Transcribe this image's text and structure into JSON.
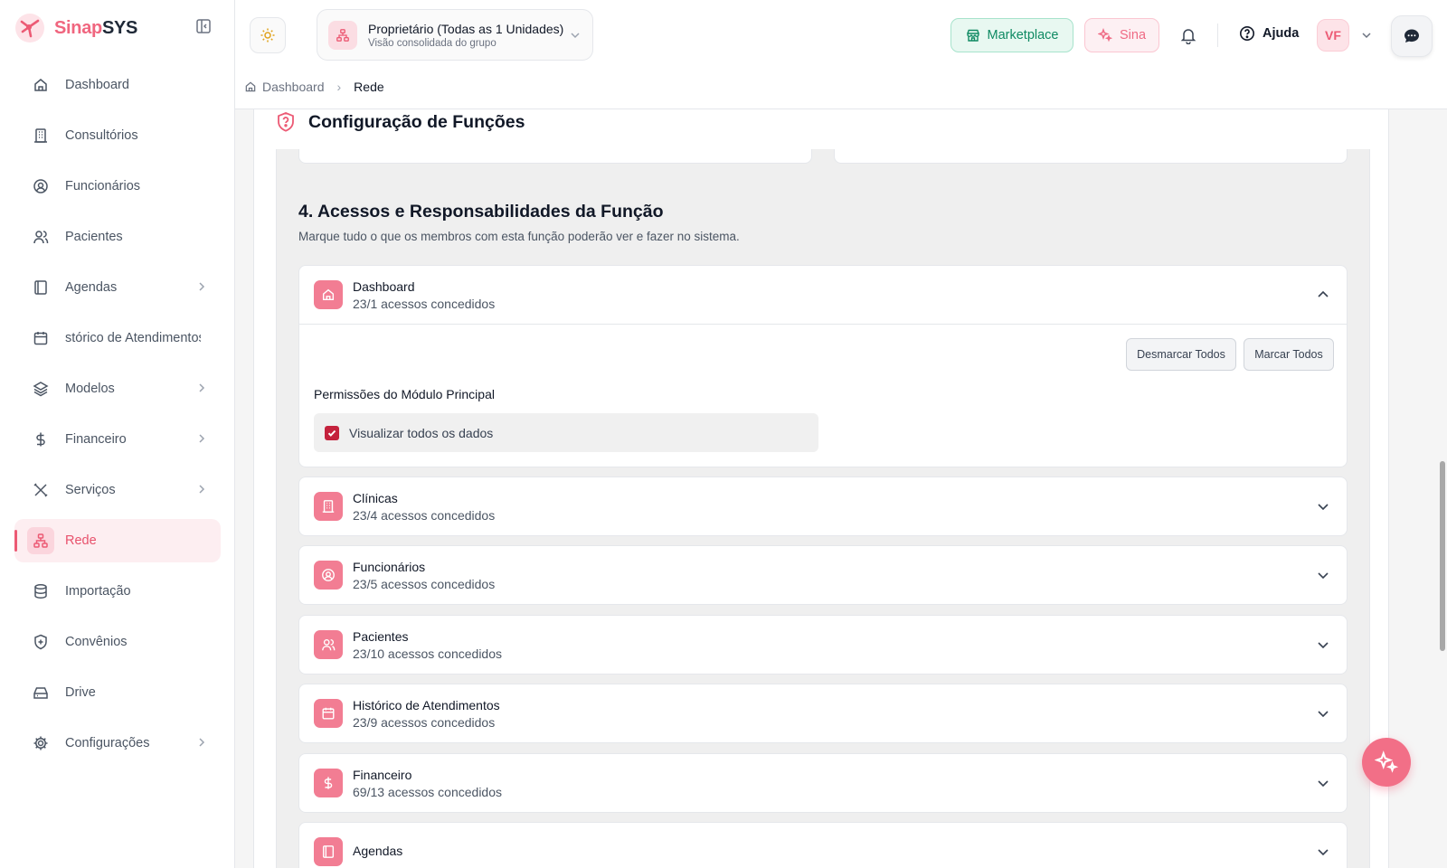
{
  "app": {
    "name_part1": "Sinap",
    "name_part2": "SYS",
    "accent_color": "#ec5a74"
  },
  "sidebar": {
    "items": [
      {
        "label": "Dashboard",
        "icon": "home-icon"
      },
      {
        "label": "Consultórios",
        "icon": "building-icon"
      },
      {
        "label": "Funcionários",
        "icon": "user-circle-icon"
      },
      {
        "label": "Pacientes",
        "icon": "users-icon"
      },
      {
        "label": "Agendas",
        "icon": "book-icon",
        "has_submenu": true
      },
      {
        "label": "stórico de Atendimentos",
        "icon": "calendar-icon"
      },
      {
        "label": "Modelos",
        "icon": "layers-icon",
        "has_submenu": true
      },
      {
        "label": "Financeiro",
        "icon": "dollar-icon",
        "has_submenu": true
      },
      {
        "label": "Serviços",
        "icon": "tools-icon",
        "has_submenu": true
      },
      {
        "label": "Rede",
        "icon": "network-icon",
        "active": true
      },
      {
        "label": "Importação",
        "icon": "database-icon"
      },
      {
        "label": "Convênios",
        "icon": "shield-plus-icon"
      },
      {
        "label": "Drive",
        "icon": "hard-drive-icon"
      },
      {
        "label": "Configurações",
        "icon": "gear-icon",
        "has_submenu": true
      }
    ]
  },
  "topbar": {
    "unit_title": "Proprietário (Todas as 1 Unidades)",
    "unit_subtitle": "Visão consolidada do grupo",
    "marketplace_label": "Marketplace",
    "sina_label": "Sina",
    "help_label": "Ajuda",
    "avatar_initials": "VF"
  },
  "breadcrumb": {
    "home": "Dashboard",
    "current": "Rede"
  },
  "page": {
    "card_title": "Configuração de Funções",
    "section_title": "4. Acessos e Responsabilidades da Função",
    "section_subtitle": "Marque tudo o que os membros com esta função poderão ver e fazer no sistema.",
    "deselect_all": "Desmarcar Todos",
    "select_all": "Marcar Todos",
    "perm_section_title": "Permissões do Módulo Principal",
    "perm_item": "Visualizar todos os dados",
    "perm_item_checked": true
  },
  "modules": [
    {
      "name": "Dashboard",
      "count": "23/1 acessos concedidos",
      "icon": "home-icon",
      "expanded": true
    },
    {
      "name": "Clínicas",
      "count": "23/4 acessos concedidos",
      "icon": "building-icon"
    },
    {
      "name": "Funcionários",
      "count": "23/5 acessos concedidos",
      "icon": "user-circle-icon"
    },
    {
      "name": "Pacientes",
      "count": "23/10 acessos concedidos",
      "icon": "users-icon"
    },
    {
      "name": "Histórico de Atendimentos",
      "count": "23/9 acessos concedidos",
      "icon": "calendar-icon"
    },
    {
      "name": "Financeiro",
      "count": "69/13 acessos concedidos",
      "icon": "dollar-icon"
    },
    {
      "name": "Agendas",
      "count": "",
      "icon": "book-icon"
    }
  ]
}
